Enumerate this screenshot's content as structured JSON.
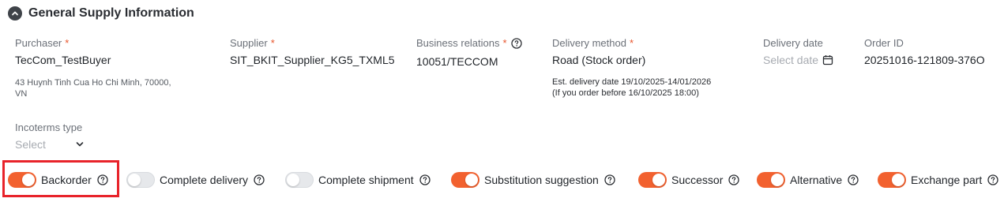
{
  "section": {
    "title": "General Supply Information"
  },
  "purchaser": {
    "label": "Purchaser",
    "required": "*",
    "value": "TecCom_TestBuyer",
    "address_line1": "43 Huynh Tinh Cua Ho Chi Minh, 70000,",
    "address_line2": "VN"
  },
  "supplier": {
    "label": "Supplier",
    "required": "*",
    "value": "SIT_BKIT_Supplier_KG5_TXML5"
  },
  "business_relations": {
    "label": "Business relations",
    "required": "*",
    "value": "10051/TECCOM"
  },
  "delivery_method": {
    "label": "Delivery method",
    "required": "*",
    "value": "Road (Stock order)",
    "est_line1": "Est. delivery date 19/10/2025-14/01/2026",
    "est_line2": "(If you order before 16/10/2025 18:00)"
  },
  "delivery_date": {
    "label": "Delivery date",
    "placeholder": "Select date"
  },
  "order_id": {
    "label": "Order ID",
    "value": "20251016-121809-376O"
  },
  "incoterms": {
    "label": "Incoterms type",
    "placeholder": "Select"
  },
  "toggles": [
    {
      "label": "Backorder",
      "on": true
    },
    {
      "label": "Complete delivery",
      "on": false
    },
    {
      "label": "Complete shipment",
      "on": false
    },
    {
      "label": "Substitution suggestion",
      "on": true
    },
    {
      "label": "Successor",
      "on": true
    },
    {
      "label": "Alternative",
      "on": true
    },
    {
      "label": "Exchange part",
      "on": true
    }
  ],
  "colors": {
    "accent": "#f2612f",
    "required": "#e8542b",
    "highlight": "#e8232a"
  }
}
